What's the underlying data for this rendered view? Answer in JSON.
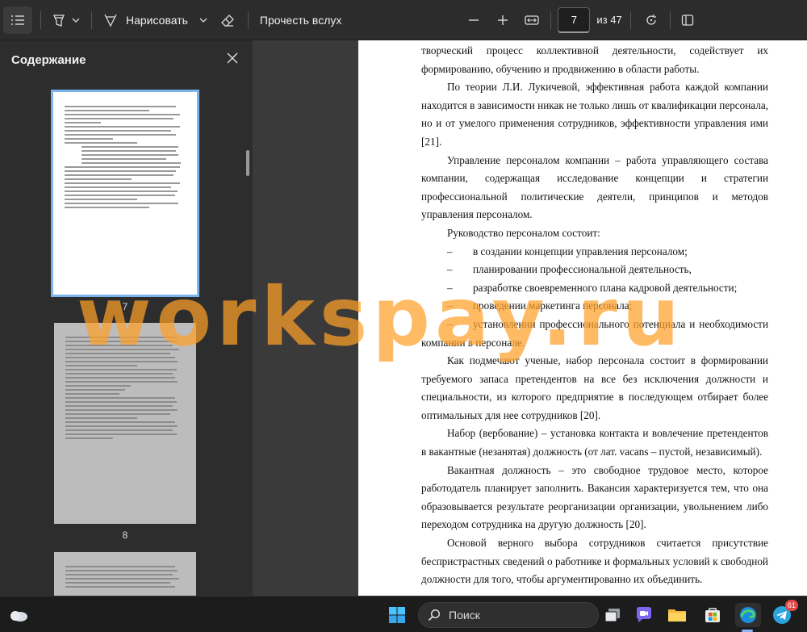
{
  "toolbar": {
    "draw_label": "Нарисовать",
    "read_aloud_label": "Прочесть вслух",
    "current_page": "7",
    "page_total": "из 47",
    "icons": [
      "contents-icon",
      "highlighter-icon",
      "chevron-down-icon",
      "draw-icon",
      "eraser-icon",
      "zoom-out-icon",
      "zoom-in-icon",
      "fit-width-icon",
      "rotate-icon",
      "page-view-icon"
    ]
  },
  "sidebar": {
    "title": "Содержание",
    "thumbnails": [
      {
        "page": "7"
      },
      {
        "page": "8"
      }
    ]
  },
  "document": {
    "paragraphs": [
      "творческий процесс коллективной деятельности, содействует их формированию, обучению и продвижению в области работы.",
      "По теории Л.И. Лукичевой, эффективная работа каждой компании находится в зависимости никак не только лишь от квалификации персонала, но и от умелого применения сотрудников, эффективности управления ими [21].",
      "Управление персоналом компании – работа управляющего состава компании, содержащая исследование концепции и стратегии профессиональной политические деятели, принципов и методов управления персоналом.",
      "Руководство персоналом состоит:"
    ],
    "list_items": [
      "в создании концепции управления персоналом;",
      "планировании профессиональной деятельность,",
      "разработке своевременного плана кадровой деятельности;",
      "проведении маркетинга персонала;",
      "установлении профессионального потенциала и необходимости компании в персонале."
    ],
    "list_marker": "–",
    "paragraphs_after": [
      "Как подмечают ученые, набор персонала состоит в формировании требуемого запаса претендентов на все без исключения должности и специальности, из которого предприятие в последующем отбирает более оптимальных для нее сотрудников [20].",
      "Набор (вербование) – установка контакта и вовлечение претендентов в вакантные (незанятая) должность (от лат. vacans – пустой, независимый).",
      "Вакантная должность – это свободное трудовое место, которое работодатель планирует заполнить. Вакансия характеризуется тем, что она образовывается результате реорганизации организации, увольнением либо переходом сотрудника на другую должность [20].",
      "Основой верного выбора сотрудников считается присутствие беспристрастных сведений о работнике и формальных условий к свободной должности для того, чтобы аргументированно их объединить."
    ]
  },
  "watermark": "workspay.ru",
  "taskbar": {
    "search_label": "Поиск",
    "telegram_badge": "61",
    "icons": [
      "weather-icon",
      "windows-start-icon",
      "search-icon",
      "task-view-icon",
      "chat-icon",
      "file-explorer-icon",
      "store-icon",
      "edge-icon",
      "telegram-icon"
    ]
  },
  "colors": {
    "toolbar_bg": "#2c2c2c",
    "sidebar_bg": "#2d2d2d",
    "viewer_bg": "#3a3a3a",
    "selection_outline": "#7ab4ea",
    "watermark": "#ffa028",
    "taskbar_bg": "#1c1c1c"
  }
}
